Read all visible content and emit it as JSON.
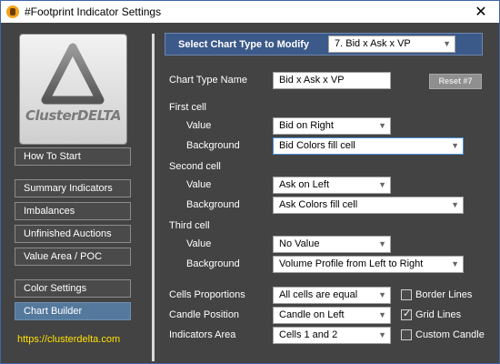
{
  "window": {
    "title": "#Footprint Indicator Settings",
    "close_symbol": "✕"
  },
  "sidebar": {
    "logo_text": "ClusterDELTA",
    "items": [
      {
        "label": "How To Start",
        "active": false
      },
      {
        "label": "Summary Indicators",
        "active": false
      },
      {
        "label": "Imbalances",
        "active": false
      },
      {
        "label": "Unfinished Auctions",
        "active": false
      },
      {
        "label": "Value Area / POC",
        "active": false
      },
      {
        "label": "Color Settings",
        "active": false
      },
      {
        "label": "Chart Builder",
        "active": true
      }
    ],
    "link": "https://clusterdelta.com"
  },
  "main": {
    "header_label": "Select Chart Type to Modify",
    "chart_type_selected": "7. Bid x Ask x VP",
    "chart_type_name_label": "Chart Type Name",
    "chart_type_name_value": "Bid x Ask x VP",
    "reset_label": "Reset #7",
    "first_cell": {
      "heading": "First cell",
      "value_label": "Value",
      "value": "Bid on Right",
      "background_label": "Background",
      "background": "Bid Colors fill cell"
    },
    "second_cell": {
      "heading": "Second cell",
      "value_label": "Value",
      "value": "Ask on Left",
      "background_label": "Background",
      "background": "Ask Colors fill cell"
    },
    "third_cell": {
      "heading": "Third cell",
      "value_label": "Value",
      "value": "No Value",
      "background_label": "Background",
      "background": "Volume Profile from Left to Right"
    },
    "cells_proportions_label": "Cells Proportions",
    "cells_proportions": "All cells are equal",
    "candle_position_label": "Candle Position",
    "candle_position": "Candle on Left",
    "indicators_area_label": "Indicators Area",
    "indicators_area": "Cells 1 and 2",
    "checkboxes": [
      {
        "label": "Border Lines",
        "checked": false
      },
      {
        "label": "Grid Lines",
        "checked": true
      },
      {
        "label": "Custom Candle",
        "checked": false
      }
    ]
  },
  "colors": {
    "background": "#434343",
    "header_bar": "#3b5a8a",
    "active_nav": "#55799c",
    "link": "#ffe000"
  }
}
